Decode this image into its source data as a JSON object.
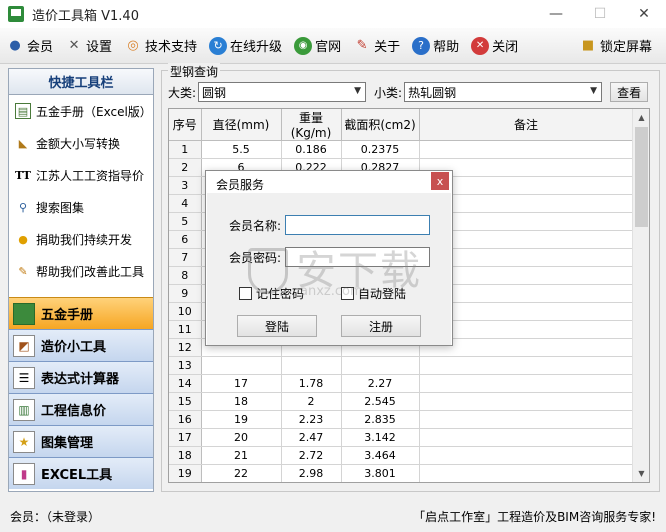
{
  "window": {
    "title": "造价工具箱 V1.40",
    "min_label": "—",
    "max_label": "☐",
    "close_label": "✕"
  },
  "toolbar": {
    "items": [
      {
        "label": "会员",
        "icon": "user-icon"
      },
      {
        "label": "设置",
        "icon": "wrench-icon"
      },
      {
        "label": "技术支持",
        "icon": "support-icon"
      },
      {
        "label": "在线升级",
        "icon": "refresh-icon"
      },
      {
        "label": "官网",
        "icon": "globe-icon"
      },
      {
        "label": "关于",
        "icon": "pin-icon"
      },
      {
        "label": "帮助",
        "icon": "help-icon"
      },
      {
        "label": "关闭",
        "icon": "close-circle-icon"
      }
    ],
    "lock_label": "锁定屏幕"
  },
  "left_panel": {
    "header": "快捷工具栏",
    "tools": [
      {
        "label": "五金手册（Excel版）",
        "icon": "table-icon"
      },
      {
        "label": "金额大小写转换",
        "icon": "ruler-icon"
      },
      {
        "label": "江苏人工工资指导价",
        "icon": "text-icon"
      },
      {
        "label": "搜索图集",
        "icon": "search-icon"
      },
      {
        "label": "捐助我们持续开发",
        "icon": "medal-icon"
      },
      {
        "label": "帮助我们改善此工具",
        "icon": "edit-icon"
      }
    ],
    "nav": [
      {
        "label": "五金手册",
        "active": true
      },
      {
        "label": "造价小工具",
        "active": false
      },
      {
        "label": "表达式计算器",
        "active": false
      },
      {
        "label": "工程信息价",
        "active": false
      },
      {
        "label": "图集管理",
        "active": false
      },
      {
        "label": "EXCEL工具",
        "active": false
      }
    ]
  },
  "query": {
    "group_title": "型钢查询",
    "category_label": "大类:",
    "category_value": "圆钢",
    "subcategory_label": "小类:",
    "subcategory_value": "热轧圆钢",
    "view_button": "查看"
  },
  "table": {
    "headers": [
      "序号",
      "直径(mm)",
      "重量(Kg/m)",
      "截面积(cm2)",
      "备注"
    ],
    "rows": [
      [
        "1",
        "5.5",
        "0.186",
        "0.2375",
        ""
      ],
      [
        "2",
        "6",
        "0.222",
        "0.2827",
        ""
      ],
      [
        "3",
        "6.5",
        "0.26",
        "0.3318",
        ""
      ],
      [
        "4",
        "",
        "",
        "",
        ""
      ],
      [
        "5",
        "",
        "",
        "",
        ""
      ],
      [
        "6",
        "",
        "",
        "",
        ""
      ],
      [
        "7",
        "",
        "",
        "",
        ""
      ],
      [
        "8",
        "",
        "",
        "",
        ""
      ],
      [
        "9",
        "",
        "",
        "",
        ""
      ],
      [
        "10",
        "",
        "",
        "",
        ""
      ],
      [
        "11",
        "",
        "",
        "",
        ""
      ],
      [
        "12",
        "",
        "",
        "",
        ""
      ],
      [
        "13",
        "",
        "",
        "",
        ""
      ],
      [
        "14",
        "17",
        "1.78",
        "2.27",
        ""
      ],
      [
        "15",
        "18",
        "2",
        "2.545",
        ""
      ],
      [
        "16",
        "19",
        "2.23",
        "2.835",
        ""
      ],
      [
        "17",
        "20",
        "2.47",
        "3.142",
        ""
      ],
      [
        "18",
        "21",
        "2.72",
        "3.464",
        ""
      ],
      [
        "19",
        "22",
        "2.98",
        "3.801",
        ""
      ],
      [
        "20",
        "23",
        "3.26",
        "4.155",
        ""
      ]
    ]
  },
  "dialog": {
    "title": "会员服务",
    "close_label": "x",
    "username_label": "会员名称:",
    "password_label": "会员密码:",
    "username_value": "",
    "password_value": "",
    "remember_label": "记住密码",
    "autologin_label": "自动登陆",
    "login_button": "登陆",
    "register_button": "注册"
  },
  "watermark": {
    "text": "安下载",
    "sub": "anxz.com"
  },
  "status": {
    "left": "会员：（未登录）",
    "right": "「启点工作室」工程造价及BIM咨询服务专家!"
  }
}
